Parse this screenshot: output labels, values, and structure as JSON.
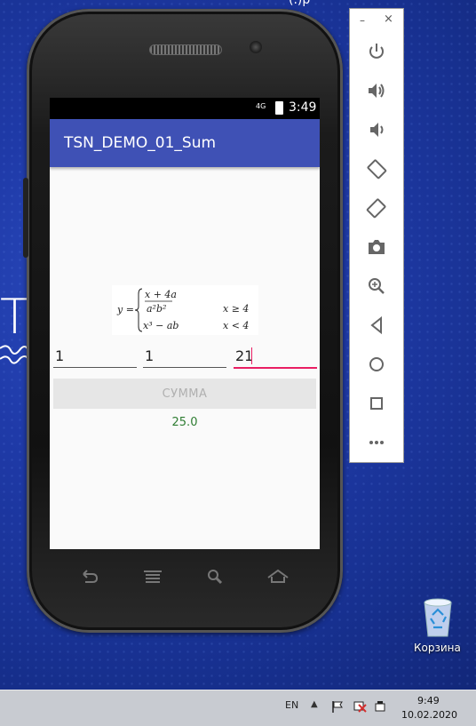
{
  "desktop": {
    "logo_text": "ТУ",
    "top_cut_text": "(.)р",
    "recycle_bin_label": "Корзина"
  },
  "phone": {
    "status_bar": {
      "network": "4G",
      "time": "3:49"
    },
    "app_title": "TSN_DEMO_01_Sum",
    "formula": {
      "lhs": "y =",
      "case1_expr": "x + 4a",
      "case2_expr": "a²b²",
      "case3_expr": "x³ − ab",
      "cond1": "x ≥ 4",
      "cond2": "x < 4"
    },
    "inputs": {
      "field1": "1",
      "field2": "1",
      "field3": "21"
    },
    "sum_button_label": "СУММА",
    "result": "25.0",
    "nav_icons": [
      "back-icon",
      "menu-icon",
      "search-icon",
      "home-icon"
    ]
  },
  "emulator_toolbar": {
    "minimize": "–",
    "close": "×",
    "buttons": [
      "power-icon",
      "volume-up-icon",
      "volume-down-icon",
      "rotate-left-icon",
      "rotate-right-icon",
      "camera-icon",
      "zoom-icon",
      "back-icon",
      "home-icon",
      "overview-icon",
      "more-icon"
    ]
  },
  "taskbar": {
    "language": "EN",
    "tray_caret": "▲",
    "time": "9:49",
    "date": "10.02.2020"
  },
  "colors": {
    "appbar": "#3f51b5",
    "accent": "#e91e63",
    "result": "#2e7d32",
    "desktop": "#1f3aa8"
  }
}
